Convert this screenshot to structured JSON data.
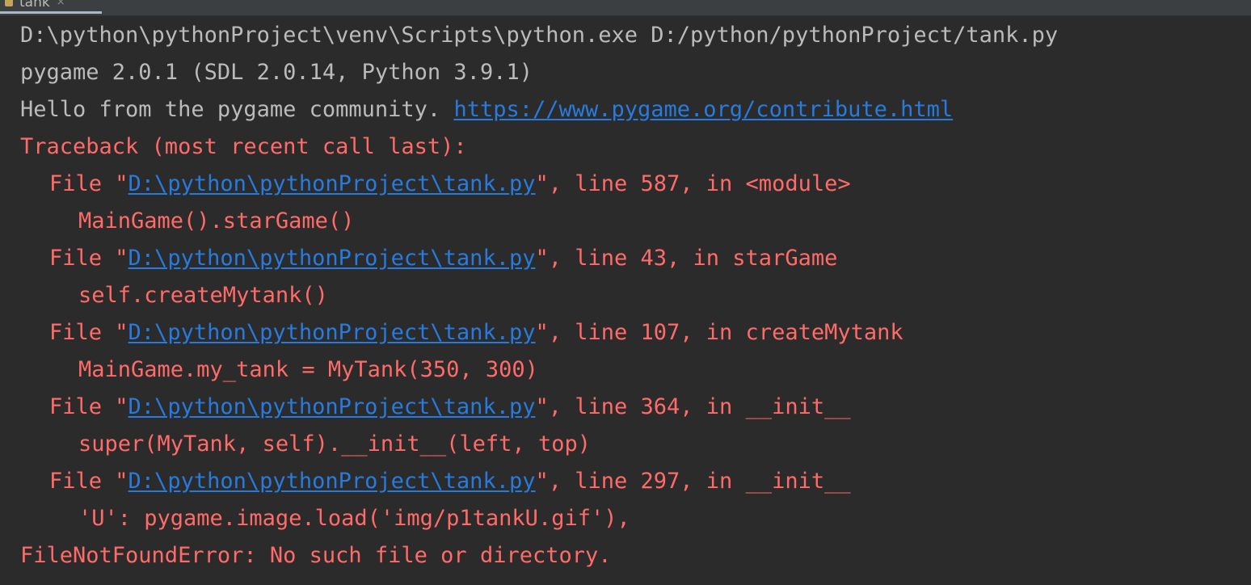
{
  "tab": {
    "title": "tank",
    "close_glyph": "×"
  },
  "console": {
    "command": "D:\\python\\pythonProject\\venv\\Scripts\\python.exe D:/python/pythonProject/tank.py",
    "pygame_version": "pygame 2.0.1 (SDL 2.0.14, Python 3.9.1)",
    "hello_text": "Hello from the pygame community. ",
    "hello_link": "https://www.pygame.org/contribute.html",
    "traceback_header": "Traceback (most recent call last):",
    "frames": [
      {
        "prefix": "File \"",
        "path": "D:\\python\\pythonProject\\tank.py",
        "suffix": "\", line 587, in <module>",
        "code": "MainGame().starGame()"
      },
      {
        "prefix": "File \"",
        "path": "D:\\python\\pythonProject\\tank.py",
        "suffix": "\", line 43, in starGame",
        "code": "self.createMytank()"
      },
      {
        "prefix": "File \"",
        "path": "D:\\python\\pythonProject\\tank.py",
        "suffix": "\", line 107, in createMytank",
        "code": "MainGame.my_tank = MyTank(350, 300)"
      },
      {
        "prefix": "File \"",
        "path": "D:\\python\\pythonProject\\tank.py",
        "suffix": "\", line 364, in __init__",
        "code": "super(MyTank, self).__init__(left, top)"
      },
      {
        "prefix": "File \"",
        "path": "D:\\python\\pythonProject\\tank.py",
        "suffix": "\", line 297, in __init__",
        "code": "'U': pygame.image.load('img/p1tankU.gif'),"
      }
    ],
    "error": "FileNotFoundError: No such file or directory."
  },
  "colors": {
    "background": "#2b2b2b",
    "stdout": "#bbbbbb",
    "stderr": "#ff6b68",
    "link": "#287bde"
  }
}
